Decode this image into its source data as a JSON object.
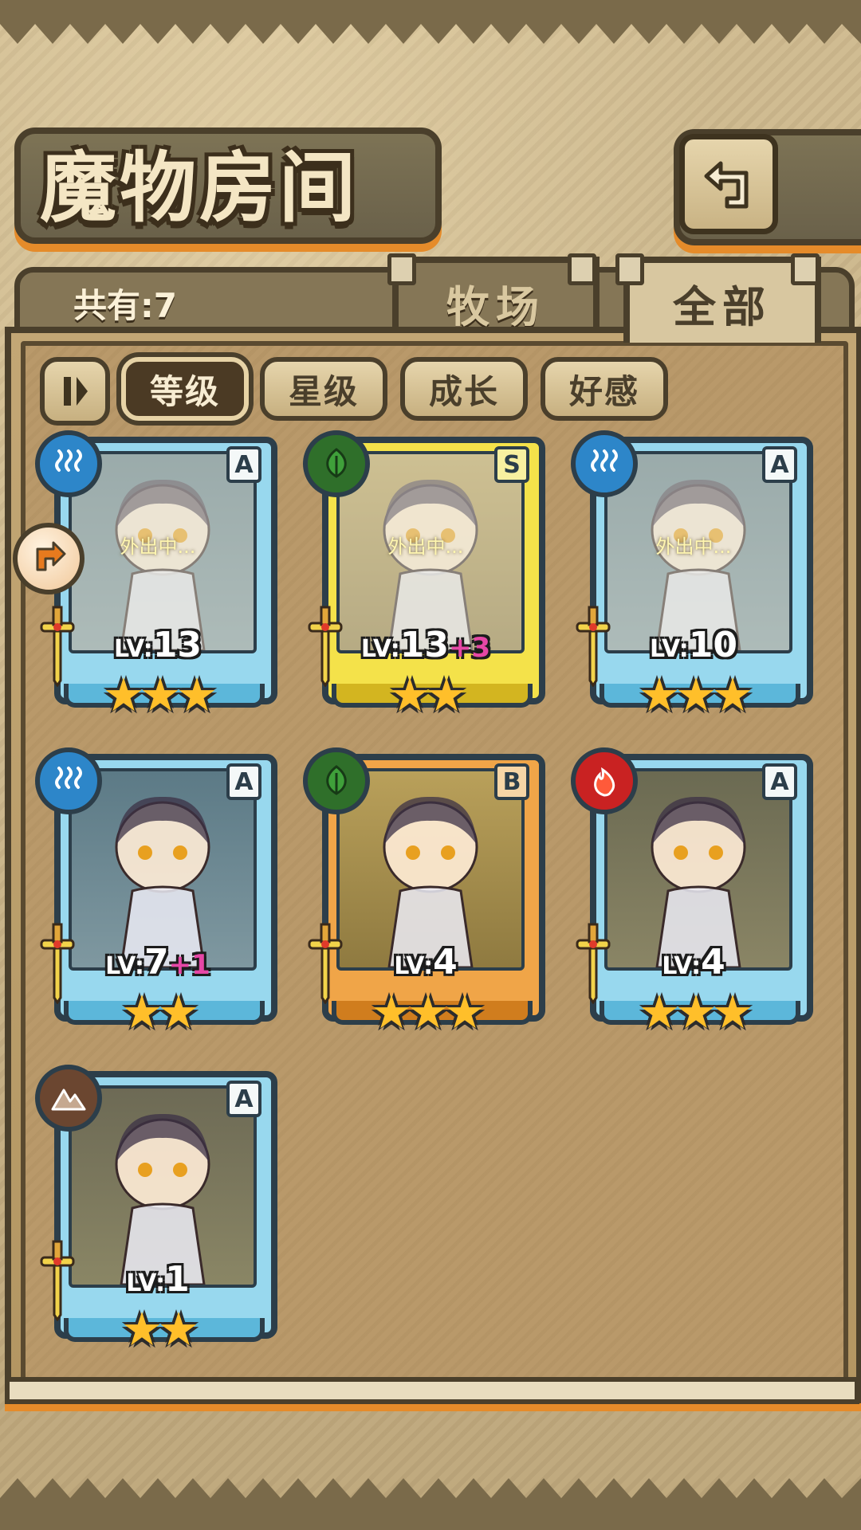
{
  "header": {
    "title": "魔物房间",
    "back_icon": "return-arrow-icon"
  },
  "summary": {
    "count_label": "共有:7"
  },
  "tabs": [
    {
      "label": "牧场",
      "active": false
    },
    {
      "label": "全部",
      "active": true
    }
  ],
  "sort": {
    "toggle_icon": "sort-order-icon",
    "buttons": [
      {
        "label": "等级",
        "active": true
      },
      {
        "label": "星级",
        "active": false
      },
      {
        "label": "成长",
        "active": false
      },
      {
        "label": "好感",
        "active": false
      }
    ]
  },
  "side_button_icon": "expand-arrow-icon",
  "monsters": [
    {
      "rank": "A",
      "element": "water",
      "lv_prefix": "LV:",
      "level": "13",
      "bonus": "",
      "stars": "★★★",
      "star_count": 3,
      "status": "外出中..."
    },
    {
      "rank": "S",
      "element": "plant",
      "lv_prefix": "LV:",
      "level": "13",
      "bonus": "+3",
      "stars": "★★",
      "star_count": 2,
      "status": "外出中..."
    },
    {
      "rank": "A",
      "element": "water",
      "lv_prefix": "LV:",
      "level": "10",
      "bonus": "",
      "stars": "★★★",
      "star_count": 3,
      "status": "外出中..."
    },
    {
      "rank": "A",
      "element": "water",
      "lv_prefix": "LV:",
      "level": "7",
      "bonus": "+1",
      "stars": "★★",
      "star_count": 2,
      "status": ""
    },
    {
      "rank": "B",
      "element": "plant",
      "lv_prefix": "LV:",
      "level": "4",
      "bonus": "",
      "stars": "★★★",
      "star_count": 3,
      "status": ""
    },
    {
      "rank": "A",
      "element": "fire",
      "lv_prefix": "LV:",
      "level": "4",
      "bonus": "",
      "stars": "★★★",
      "star_count": 3,
      "status": ""
    },
    {
      "rank": "A",
      "element": "earth",
      "lv_prefix": "LV:",
      "level": "1",
      "bonus": "",
      "stars": "★★",
      "star_count": 2,
      "status": ""
    }
  ]
}
